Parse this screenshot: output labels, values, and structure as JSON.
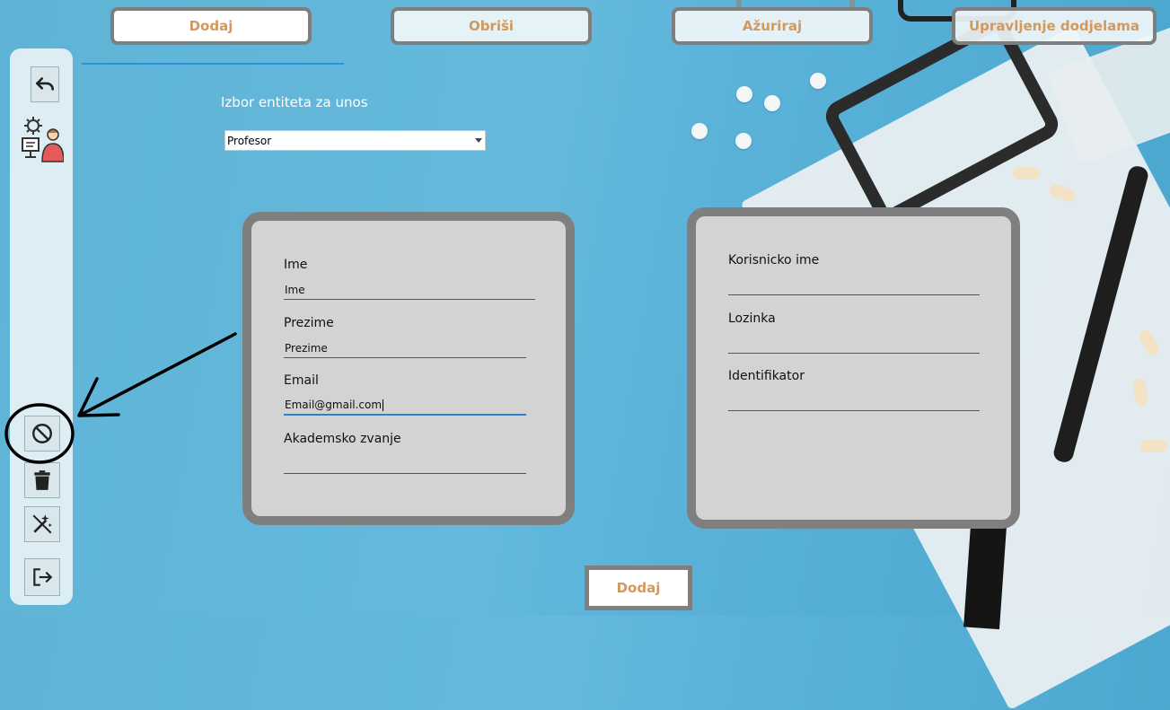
{
  "nav": {
    "add": "Dodaj",
    "delete": "Obriši",
    "update": "Ažuriraj",
    "assignments": "Upravljenje dodjelama"
  },
  "sidebar": {
    "icons": [
      "undo-icon",
      "admin-settings-icon",
      "block-icon",
      "trash-icon",
      "magic-off-icon",
      "logout-icon"
    ]
  },
  "entity_select": {
    "label": "Izbor entiteta za unos",
    "value": "Profesor"
  },
  "form_left": {
    "name_label": "Ime",
    "name_value": "Ime",
    "surname_label": "Prezime",
    "surname_value": "Prezime",
    "email_label": "Email",
    "email_value": "Email@gmail.com",
    "title_label": "Akademsko zvanje",
    "title_value": ""
  },
  "form_right": {
    "username_label": "Korisnicko ime",
    "username_value": "",
    "password_label": "Lozinka",
    "password_value": "",
    "identifier_label": "Identifikator",
    "identifier_value": ""
  },
  "submit_label": "Dodaj",
  "colors": {
    "accent_text": "#d4985c",
    "underline": "#2f8fe0",
    "panel_bg": "#d3d3d3",
    "panel_border": "#7f7f7f"
  }
}
